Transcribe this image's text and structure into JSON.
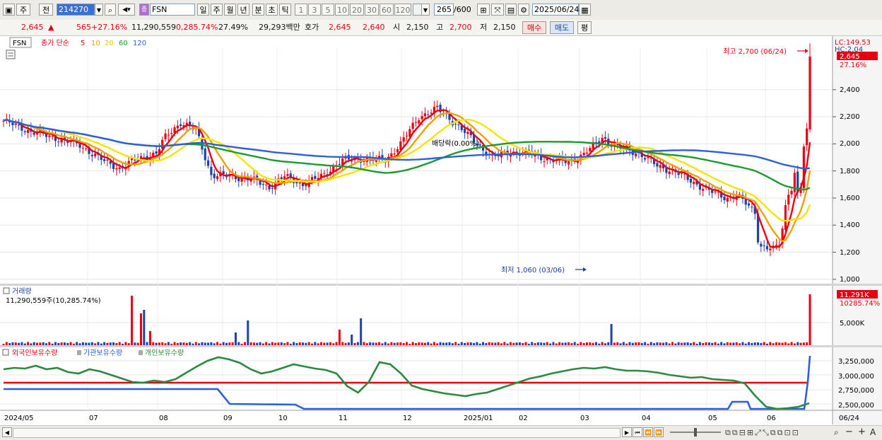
{
  "toolbar": {
    "market_btn": "주",
    "prev_btn": "전",
    "code_value": "214270",
    "name_value": "FSN",
    "name_badge": "종",
    "period_tabs": [
      "일",
      "주",
      "월",
      "년",
      "분",
      "초",
      "틱"
    ],
    "active_period": "일",
    "interval_tabs": [
      "1",
      "3",
      "5",
      "10",
      "20",
      "30",
      "60",
      "120"
    ],
    "count_value": "265",
    "count_total": "/600",
    "date_value": "2025/06/24"
  },
  "info": {
    "price": "2,645",
    "arrow": "▲",
    "change": "565",
    "change_pct": "+27.16%",
    "volume": "11,290,559",
    "volume_pct": "0,285.74%",
    "turnover": "27.49%",
    "amount": "29,293백만",
    "quote_label": "호가",
    "ask": "2,645",
    "bid": "2,640",
    "open_label": "시",
    "open": "2,150",
    "high_label": "고",
    "high": "2,700",
    "low_label": "저",
    "low": "2,150",
    "buy_btn": "매수",
    "sell_btn": "매도",
    "eval_btn": "평"
  },
  "price_panel": {
    "symbol": "FSN",
    "ma_title": "종가 단순",
    "ma_periods": [
      "5",
      "10",
      "20",
      "60",
      "120"
    ],
    "ma_colors": [
      "#e60012",
      "#f0a000",
      "#f2e600",
      "#1d9a2e",
      "#2f5fd8"
    ],
    "y_ticks": [
      "2,400",
      "2,200",
      "2,000",
      "1,800",
      "1,600",
      "1,400",
      "1,200",
      "1,000"
    ],
    "lc_label": "LC:149.53",
    "hc_label": "HC:2.04",
    "last_price_tag": "2,645",
    "last_pct_tag": "27.16%",
    "high_note": "최고 2,700 (06/24)",
    "low_note": "최저 1,060 (03/06)",
    "dividend_note": "배당락(0.00%)"
  },
  "volume_panel": {
    "title": "거래량",
    "value_text": "11,290,559주(10,285.74%)",
    "y_tick": "5,000K",
    "last_tag": "11,291K",
    "last_pct": "10285.74%"
  },
  "holding_panel": {
    "legend": [
      "외국인보유수량",
      "기관보유수량",
      "개인보유수량"
    ],
    "legend_colors": [
      "#e60012",
      "#2f5fd8",
      "#2a8a3e"
    ],
    "y_ticks": [
      "3,250,000",
      "3,000,000",
      "2,750,000",
      "2,500,000"
    ]
  },
  "x_axis": {
    "labels": [
      "2024/05",
      "07",
      "08",
      "09",
      "10",
      "11",
      "12",
      "2025/01",
      "02",
      "03",
      "04",
      "05",
      "06",
      "06/24"
    ]
  },
  "bottom_bar": {
    "nav_buttons": [
      "▶",
      "⏮",
      "⏪",
      "⏩"
    ]
  }
}
